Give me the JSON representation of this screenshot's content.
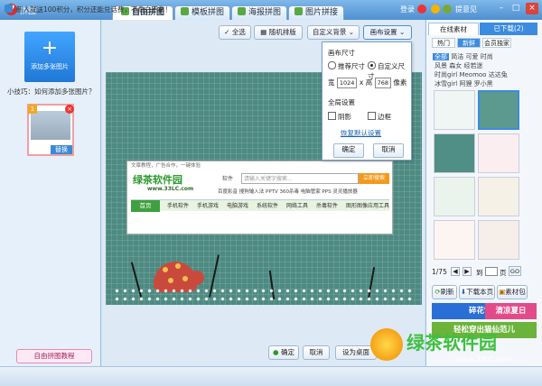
{
  "app": {
    "icon": "app-logo-icon",
    "title": "拼图"
  },
  "tabs": [
    {
      "label": "自由拼图",
      "active": true
    },
    {
      "label": "模板拼图",
      "active": false
    },
    {
      "label": "海报拼图",
      "active": false
    },
    {
      "label": "图片拼接",
      "active": false
    }
  ],
  "topbar": {
    "login": "登录",
    "feedback": "提意见"
  },
  "left": {
    "add_label": "添加多张图片",
    "tip": "小技巧：如何添加多张图片？",
    "thumb": {
      "index": "1",
      "replace": "替换"
    },
    "tutorial": "自由拼图教程"
  },
  "toolbar": {
    "select_all": "全选",
    "random_layout": "随机排版",
    "custom_bg": "自定义背景",
    "canvas_settings": "画布设置"
  },
  "popup": {
    "title": "画布尺寸",
    "recommended": "推荐尺寸",
    "custom": "自定义尺寸",
    "width_label": "宽",
    "width": "1024",
    "height_label": "高",
    "height": "768",
    "times": "x",
    "unit": "像素",
    "global": "全局设置",
    "shadow": "阴影",
    "border": "边框",
    "restore": "恢复默认设置",
    "ok": "确定",
    "cancel": "取消"
  },
  "webshot": {
    "top": "文章教程，广告合作，一键体验",
    "logo": "绿茶软件园",
    "url": "www.33LC.com",
    "category": "软件",
    "search_placeholder": "请输入关键字搜索...",
    "search_btn": "立即搜索",
    "links": "百度影音  搜狗输入法  PPTV  360杀毒  电脑管家  PPS  灵灵播放器",
    "home": "首页",
    "nav": [
      "手机软件",
      "手机游戏",
      "电脑游戏",
      "系统软件",
      "网络工具",
      "杀毒软件",
      "图形图像",
      "应用工具"
    ]
  },
  "bottom": {
    "ok": "确定",
    "cancel": "取消",
    "set_desktop": "设为桌面"
  },
  "right": {
    "tab_online": "在线素材",
    "tab_downloaded": "已下载(2)",
    "chips": [
      "热门",
      "新鲜",
      "会员独家"
    ],
    "categories": [
      [
        "全部",
        "简洁",
        "可爱",
        "时尚"
      ],
      [
        "风景",
        "森女",
        "经若迷"
      ],
      [
        "时尚girl",
        "Meomoo",
        "达达兔"
      ],
      [
        "冰雪girl",
        "阿狸",
        "罗小黑"
      ]
    ],
    "page_current": "1/75",
    "page_prefix": "到",
    "page_suffix": "页",
    "go": "GO",
    "refresh": "刷新",
    "download_page": "下载本页",
    "library": "素材包",
    "items": [
      {
        "label": "碎花雪纺",
        "color": "#2a6fd6"
      },
      {
        "label": "清凉夏日",
        "color": "#e24a8a"
      },
      {
        "label": "轻松穿出猫仙范儿",
        "color": "#6bb33a"
      }
    ]
  },
  "status": "新人就送100积分，积分还能兑话费，不拿白不拿！",
  "watermark": {
    "name": "绿茶软件园",
    "url": "www.33LC.com"
  }
}
